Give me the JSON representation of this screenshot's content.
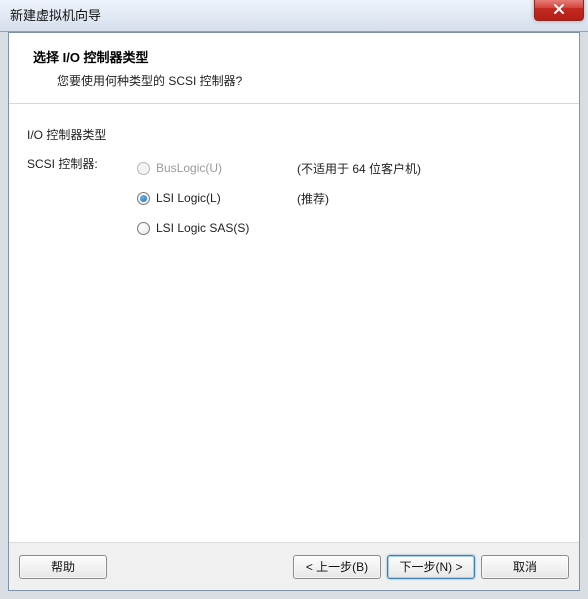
{
  "window": {
    "title": "新建虚拟机向导"
  },
  "header": {
    "title": "选择 I/O 控制器类型",
    "subtitle": "您要使用何种类型的 SCSI 控制器?"
  },
  "section": {
    "title": "I/O 控制器类型",
    "label": "SCSI 控制器:"
  },
  "options": {
    "buslogic": {
      "label": "BusLogic(U)",
      "hint": "(不适用于 64 位客户机)"
    },
    "lsilogic": {
      "label": "LSI Logic(L)",
      "hint": "(推荐)"
    },
    "lsisas": {
      "label": "LSI Logic SAS(S)",
      "hint": ""
    }
  },
  "footer": {
    "help": "帮助",
    "back": "< 上一步(B)",
    "next": "下一步(N) >",
    "cancel": "取消"
  }
}
